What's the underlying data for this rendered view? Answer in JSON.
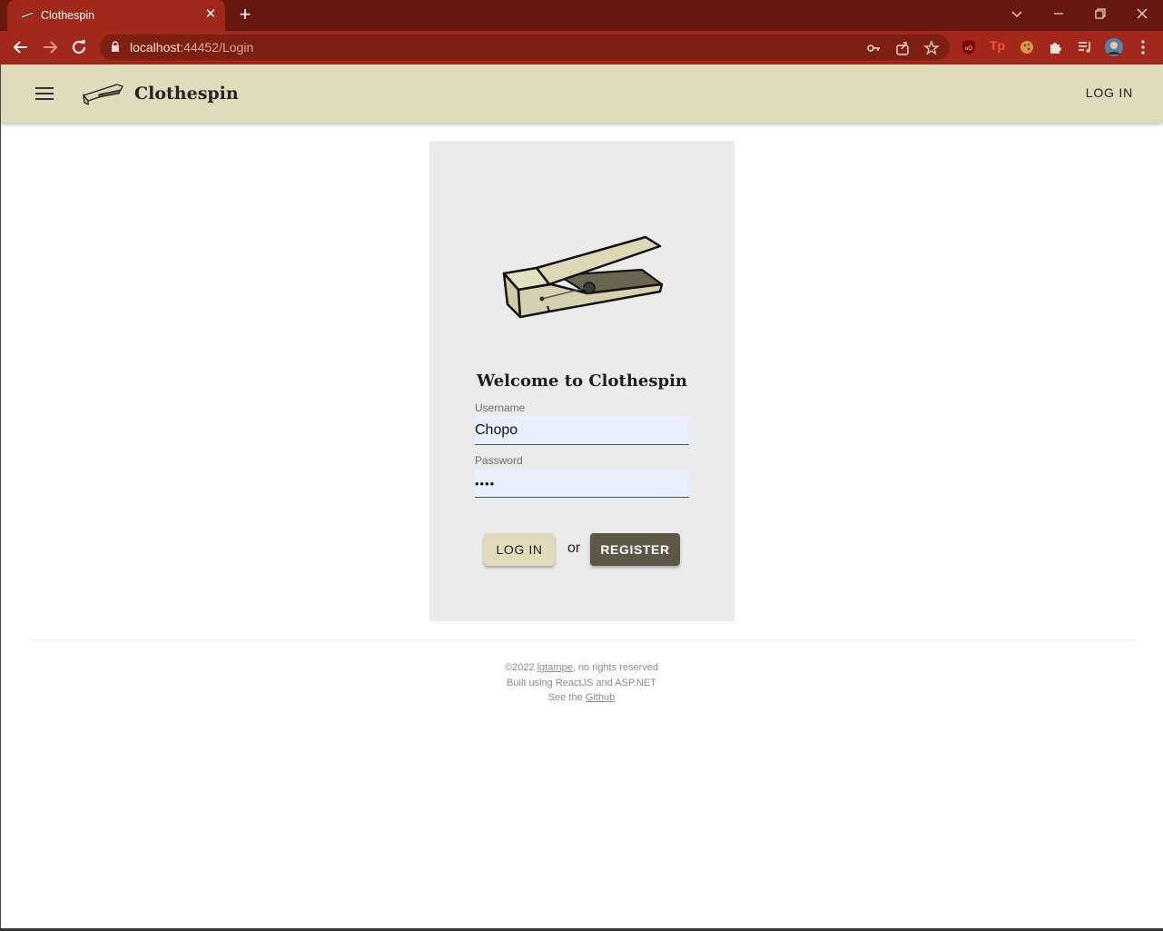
{
  "browser": {
    "tab_title": "Clothespin",
    "url_host": "localhost",
    "url_path": ":44452/Login"
  },
  "appbar": {
    "brand": "Clothespin",
    "login_label": "LOG IN"
  },
  "login": {
    "welcome": "Welcome to Clothespin",
    "username_label": "Username",
    "username_value": "Chopo",
    "password_label": "Password",
    "password_value": "••••",
    "login_button": "LOG IN",
    "or_text": "or",
    "register_button": "REGISTER"
  },
  "footer": {
    "line1_prefix": "©2022 ",
    "line1_link": "lgtampe",
    "line1_suffix": ", no rights reserved",
    "line2": "Built using ReactJS and ASP.NET",
    "line3_prefix": "See the ",
    "line3_link": "Github"
  },
  "colors": {
    "chrome_dark": "#66180e",
    "chrome_accent": "#a1281a",
    "appbar_bg": "#e0dbbb",
    "card_bg": "#ebebeb",
    "register_bg": "#5c5746"
  }
}
